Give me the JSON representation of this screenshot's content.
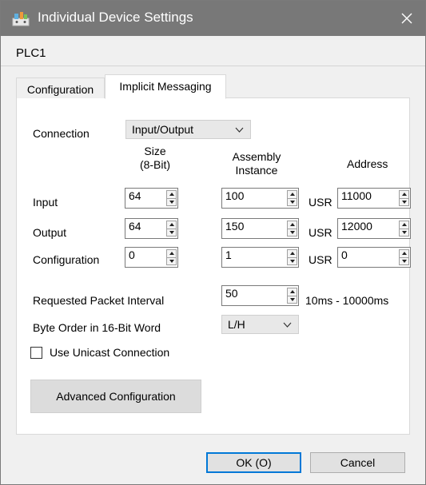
{
  "window": {
    "title": "Individual Device Settings",
    "close_icon": "close-icon",
    "app_icon": "device-settings-icon"
  },
  "device_name": "PLC1",
  "tabs": [
    {
      "label": "Configuration",
      "active": false
    },
    {
      "label": "Implicit Messaging",
      "active": true
    }
  ],
  "connection": {
    "label": "Connection",
    "value": "Input/Output"
  },
  "headers": {
    "size_line1": "Size",
    "size_line2": "(8-Bit)",
    "assembly_line1": "Assembly",
    "assembly_line2": "Instance",
    "address": "Address"
  },
  "rows": [
    {
      "label": "Input",
      "size": "64",
      "assembly": "100",
      "prefix": "USR",
      "address": "11000"
    },
    {
      "label": "Output",
      "size": "64",
      "assembly": "150",
      "prefix": "USR",
      "address": "12000"
    },
    {
      "label": "Configuration",
      "size": "0",
      "assembly": "1",
      "prefix": "USR",
      "address": "0"
    }
  ],
  "rpi": {
    "label": "Requested Packet Interval",
    "value": "50",
    "range": "10ms - 10000ms"
  },
  "byte_order": {
    "label": "Byte Order in 16-Bit Word",
    "value": "L/H"
  },
  "unicast": {
    "label": "Use Unicast Connection",
    "checked": false
  },
  "buttons": {
    "advanced": "Advanced Configuration",
    "ok": "OK (O)",
    "cancel": "Cancel"
  },
  "colors": {
    "titlebar": "#787878",
    "dialog_bg": "#f0f0f0",
    "focus_border": "#0078d7"
  }
}
